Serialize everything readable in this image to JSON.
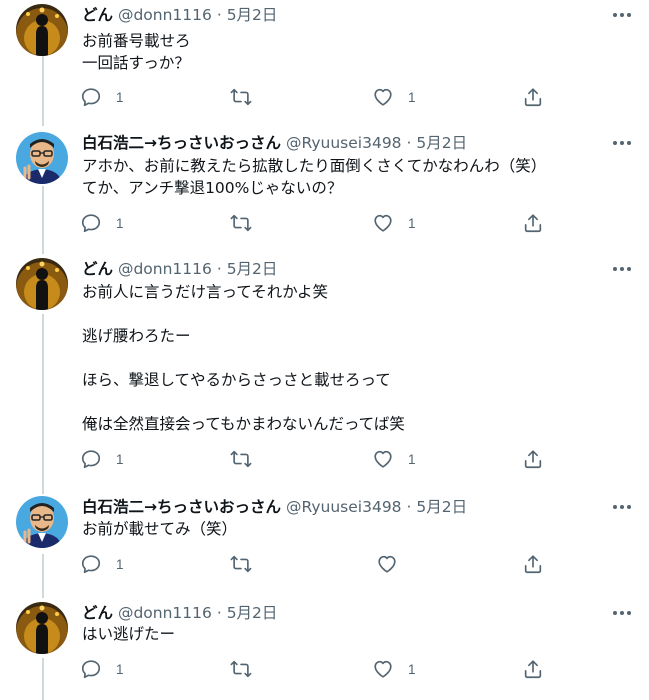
{
  "tweets": [
    {
      "name": "どん",
      "handle": "@donn1116",
      "dot": "·",
      "date": "5月2日",
      "text": "お前番号載せろ\n一回話すっか？",
      "reply_count": "1",
      "retweet_count": "",
      "like_count": "1",
      "avatar": "dark-figure-avatar"
    },
    {
      "name": "白石浩二→ちっさいおっさん",
      "handle": "@Ryuusei3498",
      "dot": "·",
      "date": "5月2日",
      "text": "アホか、お前に教えたら拡散したり面倒くさくてかなわんわ（笑）\nてか、アンチ撃退100%じゃないの？",
      "reply_count": "1",
      "retweet_count": "",
      "like_count": "1",
      "avatar": "cartoon-man-avatar"
    },
    {
      "name": "どん",
      "handle": "@donn1116",
      "dot": "·",
      "date": "5月2日",
      "text": "お前人に言うだけ言ってそれかよ笑\n\n逃げ腰わろたー\n\nほら、撃退してやるからさっさと載せろって\n\n俺は全然直接会ってもかまわないんだってば笑",
      "reply_count": "1",
      "retweet_count": "",
      "like_count": "1",
      "avatar": "dark-figure-avatar"
    },
    {
      "name": "白石浩二→ちっさいおっさん",
      "handle": "@Ryuusei3498",
      "dot": "·",
      "date": "5月2日",
      "text": "お前が載せてみ（笑）",
      "reply_count": "1",
      "retweet_count": "",
      "like_count": "",
      "avatar": "cartoon-man-avatar"
    },
    {
      "name": "どん",
      "handle": "@donn1116",
      "dot": "·",
      "date": "5月2日",
      "text": "はい逃げたー",
      "reply_count": "1",
      "retweet_count": "",
      "like_count": "1",
      "avatar": "dark-figure-avatar"
    }
  ],
  "icons": {
    "more": "more-icon",
    "reply": "reply-icon",
    "retweet": "retweet-icon",
    "like": "like-icon",
    "share": "share-icon"
  },
  "colors": {
    "text": "#0f1419",
    "secondary": "#536471",
    "thread_line": "#cfd9de"
  }
}
